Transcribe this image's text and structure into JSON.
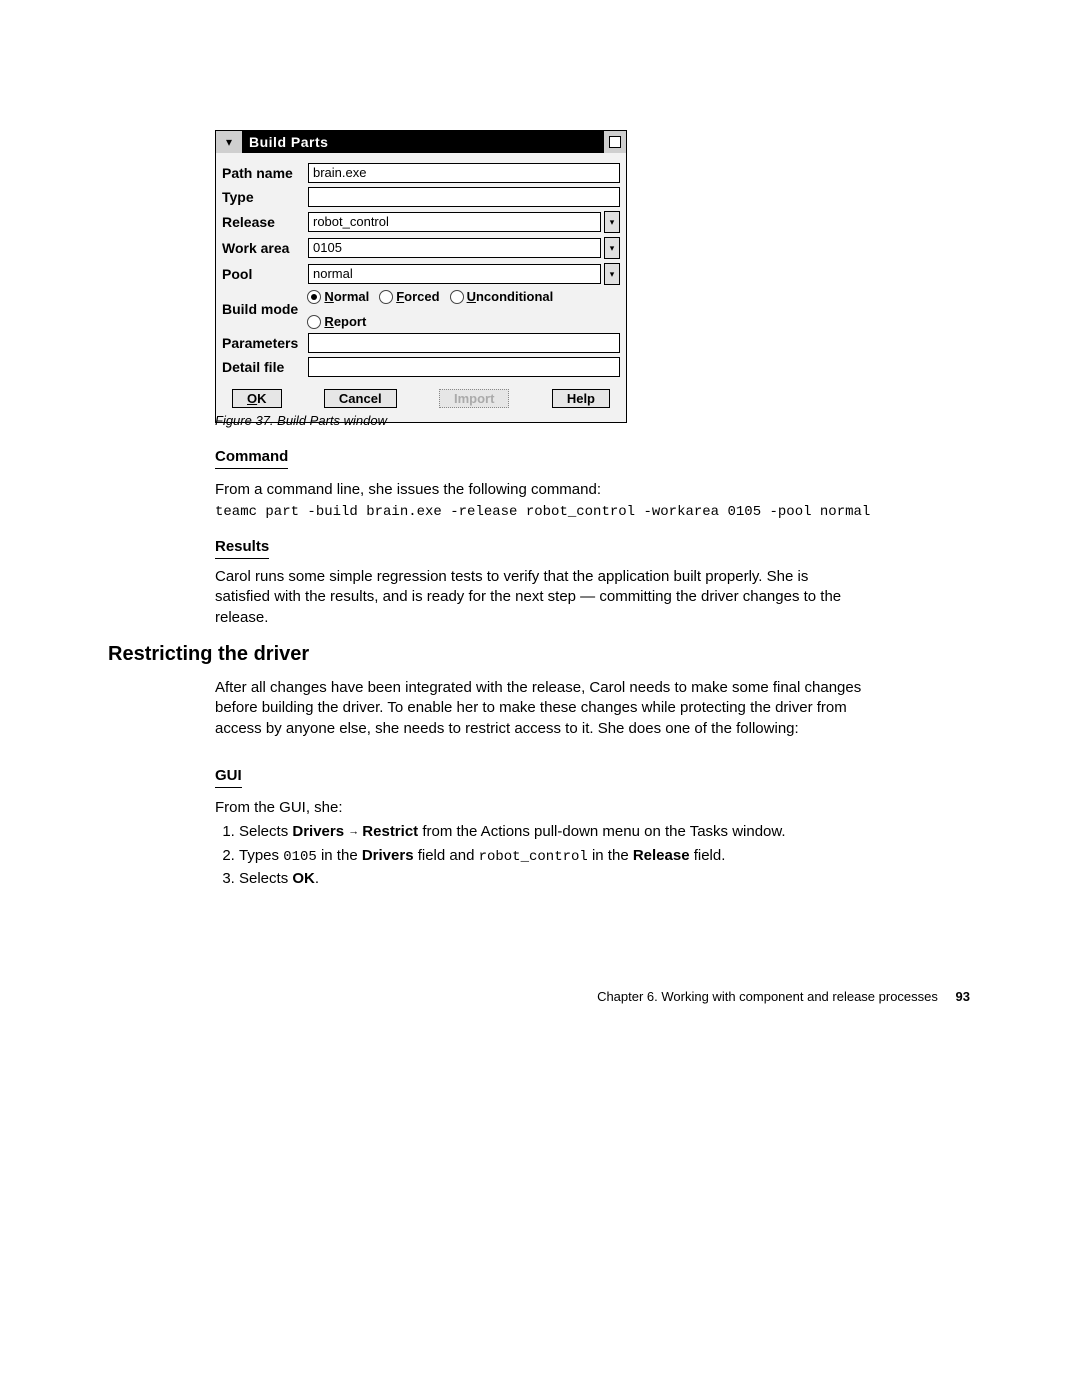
{
  "window": {
    "title": "Build Parts",
    "labels": {
      "pathname": "Path name",
      "type": "Type",
      "release": "Release",
      "workarea": "Work area",
      "pool": "Pool",
      "buildmode": "Build mode",
      "parameters": "Parameters",
      "detailfile": "Detail file"
    },
    "values": {
      "pathname": "brain.exe",
      "type": "",
      "release": "robot_control",
      "workarea": "0105",
      "pool": "normal",
      "parameters": "",
      "detailfile": ""
    },
    "buildmode": {
      "normal": "Normal",
      "forced": "Forced",
      "unconditional": "Unconditional",
      "report": "Report",
      "selected": "normal"
    },
    "buttons": {
      "ok": "OK",
      "cancel": "Cancel",
      "import": "Import",
      "help": "Help"
    }
  },
  "caption": "Figure 37. Build Parts window",
  "command": {
    "heading": "Command",
    "intro": "From a command line, she issues the following command:",
    "code": "teamc part -build brain.exe -release robot_control -workarea 0105 -pool normal"
  },
  "results": {
    "heading": "Results",
    "text": "Carol runs some simple regression tests to verify that the application built properly. She is satisfied with the results, and is ready for the next step — committing the driver changes to the release."
  },
  "restrict": {
    "heading": "Restricting the driver",
    "text": "After all changes have been integrated with the release, Carol needs to make some final changes before building the driver. To enable her to make these changes while protecting the driver from access by anyone else, she needs to restrict access to it. She does one of the following:"
  },
  "gui": {
    "heading": "GUI",
    "intro": "From the GUI, she:",
    "step1_a": "Selects ",
    "step1_b": "Drivers",
    "step1_c": "Restrict",
    "step1_d": " from the Actions pull-down menu on the Tasks window.",
    "step2_a": "Types ",
    "step2_b": "0105",
    "step2_c": " in the ",
    "step2_d": "Drivers",
    "step2_e": " field and ",
    "step2_f": "robot_control",
    "step2_g": " in the ",
    "step2_h": "Release",
    "step2_i": " field.",
    "step3_a": "Selects ",
    "step3_b": "OK",
    "step3_c": "."
  },
  "footer": {
    "chapter": "Chapter 6. Working with component and release processes",
    "page": "93"
  }
}
